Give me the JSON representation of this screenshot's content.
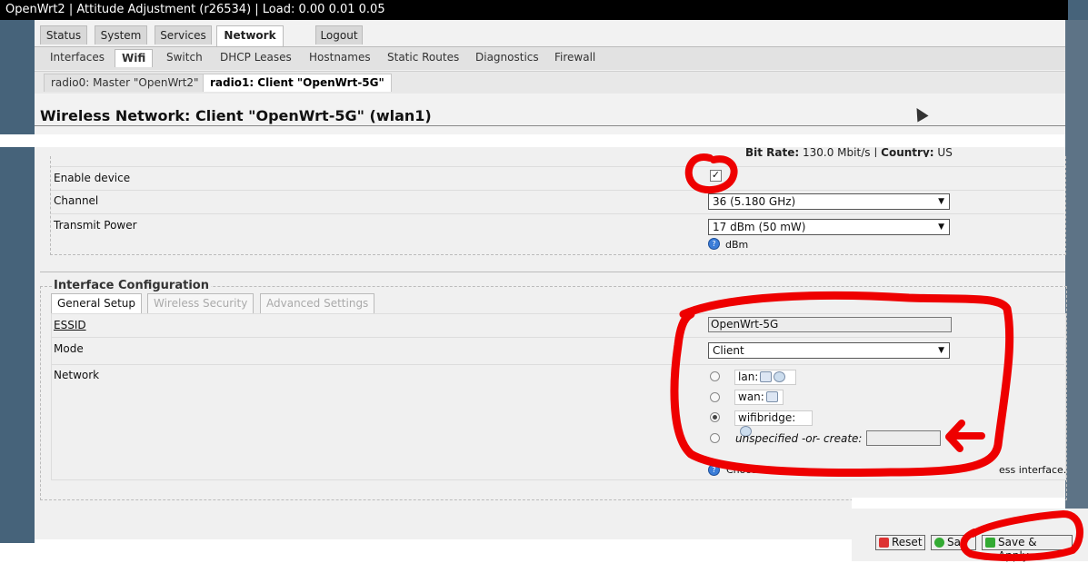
{
  "titlebar": "OpenWrt2 | Attitude Adjustment (r26534) | Load: 0.00 0.01 0.05",
  "main_tabs": [
    {
      "label": "Status"
    },
    {
      "label": "System"
    },
    {
      "label": "Services"
    },
    {
      "label": "Network"
    },
    {
      "label": "Logout"
    }
  ],
  "sub_tabs": [
    {
      "label": "Interfaces"
    },
    {
      "label": "Wifi"
    },
    {
      "label": "Switch"
    },
    {
      "label": "DHCP Leases"
    },
    {
      "label": "Hostnames"
    },
    {
      "label": "Static Routes"
    },
    {
      "label": "Diagnostics"
    },
    {
      "label": "Firewall"
    }
  ],
  "radio_tabs": [
    {
      "label": "radio0: Master \"OpenWrt2\""
    },
    {
      "label": "radio1: Client \"OpenWrt-5G\""
    }
  ],
  "heading": "Wireless Network: Client \"OpenWrt-5G\" (wlan1)",
  "device": {
    "bitrate_label": "Bit Rate:",
    "bitrate_value": "130.0 Mbit/s",
    "country_label": "Country:",
    "country_value": "US",
    "enable_label": "Enable device",
    "enable_checked": true,
    "channel_label": "Channel",
    "channel_value": "36 (5.180 GHz)",
    "txpower_label": "Transmit Power",
    "txpower_value": "17 dBm (50 mW)",
    "txpower_hint": "dBm"
  },
  "interface": {
    "legend": "Interface Configuration",
    "tabs": [
      {
        "label": "General Setup"
      },
      {
        "label": "Wireless Security"
      },
      {
        "label": "Advanced Settings"
      }
    ],
    "essid_label": "ESSID",
    "essid_value": "OpenWrt-5G",
    "mode_label": "Mode",
    "mode_value": "Client",
    "network_label": "Network",
    "networks": [
      {
        "label": "lan:",
        "selected": false
      },
      {
        "label": "wan:",
        "selected": false
      },
      {
        "label": "wifibridge:",
        "selected": true
      }
    ],
    "unspecified_label": "unspecified -or- create:",
    "unspecified_value": "",
    "network_hint_start": "Choos",
    "network_hint_end": "ess interface."
  },
  "buttons": {
    "reset": "Reset",
    "save": "Sav",
    "save_apply": "Save & Apply"
  },
  "colors": {
    "annotation_red": "#ee0000",
    "background_dark": "#46637a"
  }
}
